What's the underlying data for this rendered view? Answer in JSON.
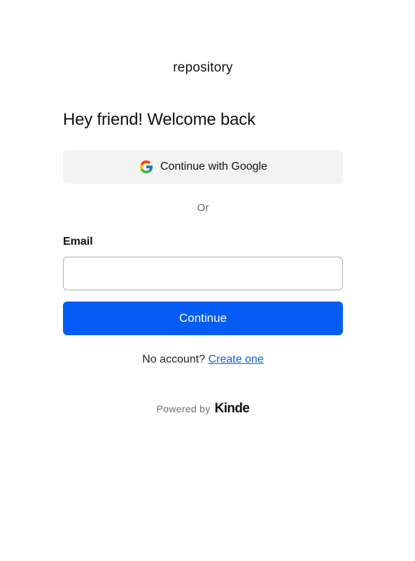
{
  "brand": {
    "name": "repository"
  },
  "heading": "Hey friend! Welcome back",
  "social": {
    "google_label": "Continue with Google",
    "google_icon": "google-icon"
  },
  "divider_text": "Or",
  "form": {
    "email_label": "Email",
    "email_value": "",
    "email_placeholder": "",
    "submit_label": "Continue"
  },
  "signup": {
    "prompt": "No account?",
    "link_label": "Create one"
  },
  "footer": {
    "powered_by": "Powered by",
    "provider": "Kinde"
  },
  "colors": {
    "primary": "#055cf5",
    "social_button_bg": "#f3f3f3",
    "input_border": "#b0b0b0"
  }
}
